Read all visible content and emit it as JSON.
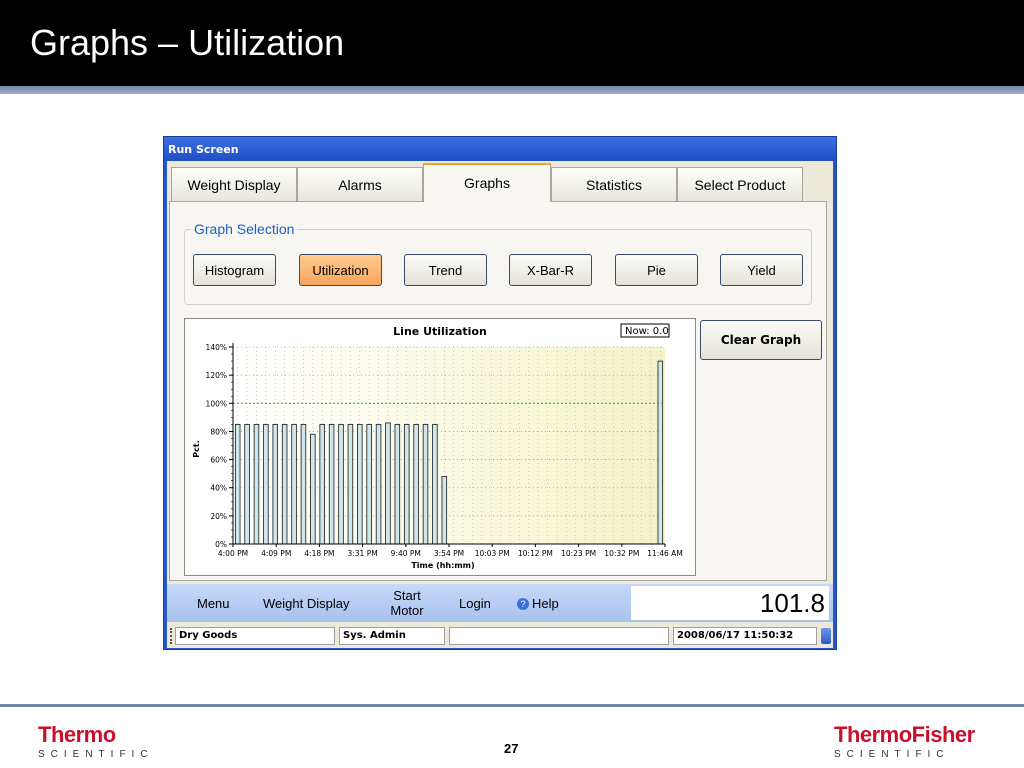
{
  "slide": {
    "title": "Graphs – Utilization",
    "page_number": "27",
    "logo_left": {
      "big": "Thermo",
      "small": "SCIENTIFIC"
    },
    "logo_right": {
      "big": "ThermoFisher",
      "small": "SCIENTIFIC"
    }
  },
  "window": {
    "title": "Run Screen",
    "tabs": [
      {
        "label": "Weight Display",
        "active": false
      },
      {
        "label": "Alarms",
        "active": false
      },
      {
        "label": "Graphs",
        "active": true
      },
      {
        "label": "Statistics",
        "active": false
      },
      {
        "label": "Select Product",
        "active": false
      }
    ],
    "graph_selection": {
      "label": "Graph Selection",
      "buttons": [
        {
          "label": "Histogram",
          "active": false
        },
        {
          "label": "Utilization",
          "active": true
        },
        {
          "label": "Trend",
          "active": false
        },
        {
          "label": "X-Bar-R",
          "active": false
        },
        {
          "label": "Pie",
          "active": false
        },
        {
          "label": "Yield",
          "active": false
        }
      ]
    },
    "clear_graph_label": "Clear Graph",
    "command_bar": {
      "menu": "Menu",
      "weight_display": "Weight Display",
      "start_motor_line1": "Start",
      "start_motor_line2": "Motor",
      "login": "Login",
      "help": "Help",
      "readout": "101.8"
    },
    "status_bar": {
      "product": "Dry Goods",
      "user": "Sys. Admin",
      "blank": "",
      "datetime": "2008/06/17 11:50:32"
    }
  },
  "colors": {
    "accent_tab": "#f7a130",
    "active_button": "#f8a55c",
    "bar_fill": "#cfe6ea",
    "target_line": "#2ea82e",
    "plot_bg_start": "#ffffff",
    "plot_bg_end": "#f4f2c6"
  },
  "chart_data": {
    "type": "bar",
    "title": "Line Utilization",
    "now_label": "Now: 0.0",
    "xlabel": "Time (hh:mm)",
    "ylabel": "Pct.",
    "ylim": [
      0,
      140
    ],
    "yticks": [
      "0%",
      "20%",
      "40%",
      "60%",
      "80%",
      "100%",
      "120%",
      "140%"
    ],
    "xtick_labels": [
      "4:00 PM",
      "4:09 PM",
      "4:18 PM",
      "3:31 PM",
      "9:40 PM",
      "3:54 PM",
      "10:03 PM",
      "10:12 PM",
      "10:23 PM",
      "10:32 PM",
      "11:46 AM"
    ],
    "target_line": 100,
    "values": [
      85,
      85,
      85,
      85,
      85,
      85,
      85,
      85,
      78,
      85,
      85,
      85,
      85,
      85,
      85,
      85,
      86,
      85,
      85,
      85,
      85,
      85,
      48,
      0,
      0,
      0,
      0,
      0,
      0,
      0,
      0,
      0,
      0,
      0,
      0,
      0,
      0,
      0,
      0,
      0,
      0,
      0,
      0,
      0,
      0,
      130
    ],
    "grid": true
  }
}
